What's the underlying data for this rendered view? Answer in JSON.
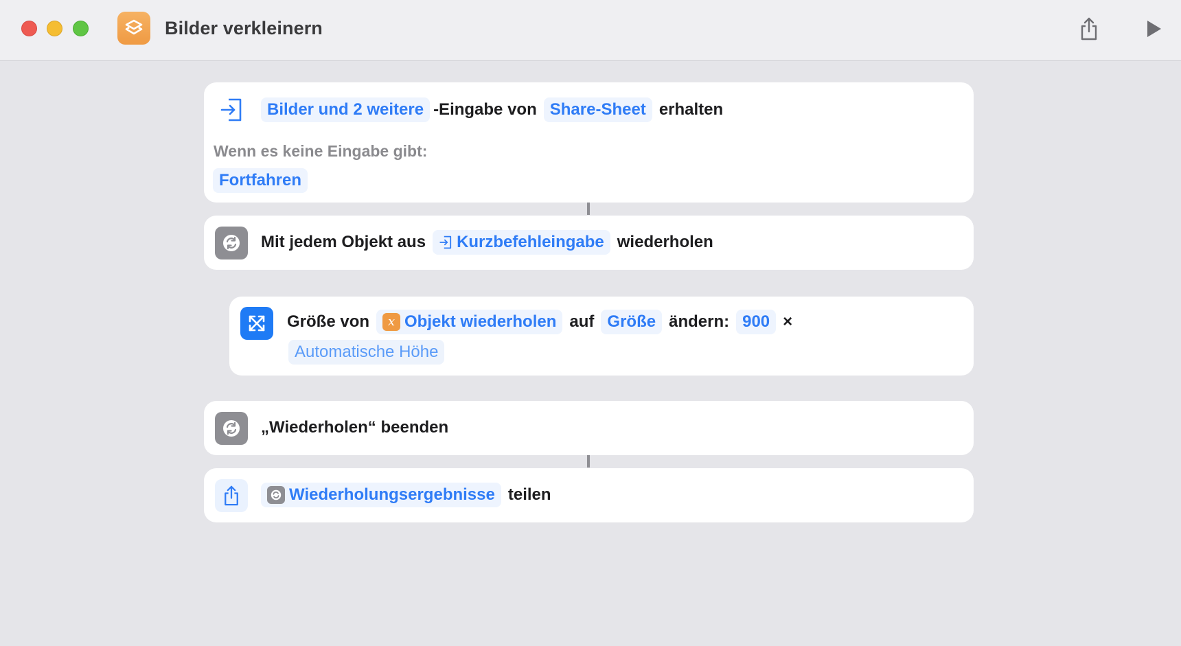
{
  "window": {
    "title": "Bilder verkleinern",
    "app_icon": "shortcuts-icon",
    "toolbar": {
      "share_icon": "share-icon",
      "run_icon": "play-icon"
    }
  },
  "actions": [
    {
      "icon": "input-arrow-icon",
      "token_input_types": "Bilder und 2 weitere",
      "text_eingabe_von": "-Eingabe von",
      "token_source": "Share-Sheet",
      "text_erhalten": "erhalten",
      "no_input_label": "Wenn es keine Eingabe gibt:",
      "no_input_value": "Fortfahren"
    },
    {
      "icon": "repeat-icon",
      "text_prefix": "Mit jedem Objekt aus",
      "token": "Kurzbefehleingabe",
      "token_icon": "input-arrow-icon",
      "text_suffix": "wiederholen"
    },
    {
      "icon": "resize-arrows-icon",
      "text_prefix": "Größe von",
      "token_variable": "Objekt wiederholen",
      "variable_badge": "x",
      "text_auf": "auf",
      "token_size": "Größe",
      "text_aendern": "ändern:",
      "token_width": "900",
      "times": "×",
      "token_height": "Automatische Höhe"
    },
    {
      "icon": "repeat-icon",
      "text": "„Wiederholen“ beenden"
    },
    {
      "icon": "share-icon",
      "token": "Wiederholungsergebnisse",
      "token_icon": "repeat-icon",
      "text_suffix": "teilen"
    }
  ],
  "colors": {
    "accent_blue": "#2f7cf6",
    "token_bg": "#eef4fe",
    "app_icon_orange": "#ef9a43",
    "repeat_gray": "#8e8e93",
    "resize_blue": "#1f7bf5"
  }
}
